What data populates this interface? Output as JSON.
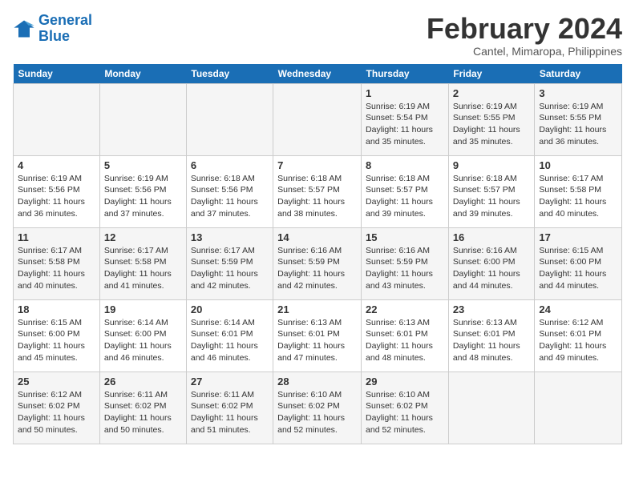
{
  "logo": {
    "general": "General",
    "blue": "Blue"
  },
  "title": "February 2024",
  "location": "Cantel, Mimaropa, Philippines",
  "days_of_week": [
    "Sunday",
    "Monday",
    "Tuesday",
    "Wednesday",
    "Thursday",
    "Friday",
    "Saturday"
  ],
  "weeks": [
    [
      {
        "day": "",
        "info": ""
      },
      {
        "day": "",
        "info": ""
      },
      {
        "day": "",
        "info": ""
      },
      {
        "day": "",
        "info": ""
      },
      {
        "day": "1",
        "info": "Sunrise: 6:19 AM\nSunset: 5:54 PM\nDaylight: 11 hours\nand 35 minutes."
      },
      {
        "day": "2",
        "info": "Sunrise: 6:19 AM\nSunset: 5:55 PM\nDaylight: 11 hours\nand 35 minutes."
      },
      {
        "day": "3",
        "info": "Sunrise: 6:19 AM\nSunset: 5:55 PM\nDaylight: 11 hours\nand 36 minutes."
      }
    ],
    [
      {
        "day": "4",
        "info": "Sunrise: 6:19 AM\nSunset: 5:56 PM\nDaylight: 11 hours\nand 36 minutes."
      },
      {
        "day": "5",
        "info": "Sunrise: 6:19 AM\nSunset: 5:56 PM\nDaylight: 11 hours\nand 37 minutes."
      },
      {
        "day": "6",
        "info": "Sunrise: 6:18 AM\nSunset: 5:56 PM\nDaylight: 11 hours\nand 37 minutes."
      },
      {
        "day": "7",
        "info": "Sunrise: 6:18 AM\nSunset: 5:57 PM\nDaylight: 11 hours\nand 38 minutes."
      },
      {
        "day": "8",
        "info": "Sunrise: 6:18 AM\nSunset: 5:57 PM\nDaylight: 11 hours\nand 39 minutes."
      },
      {
        "day": "9",
        "info": "Sunrise: 6:18 AM\nSunset: 5:57 PM\nDaylight: 11 hours\nand 39 minutes."
      },
      {
        "day": "10",
        "info": "Sunrise: 6:17 AM\nSunset: 5:58 PM\nDaylight: 11 hours\nand 40 minutes."
      }
    ],
    [
      {
        "day": "11",
        "info": "Sunrise: 6:17 AM\nSunset: 5:58 PM\nDaylight: 11 hours\nand 40 minutes."
      },
      {
        "day": "12",
        "info": "Sunrise: 6:17 AM\nSunset: 5:58 PM\nDaylight: 11 hours\nand 41 minutes."
      },
      {
        "day": "13",
        "info": "Sunrise: 6:17 AM\nSunset: 5:59 PM\nDaylight: 11 hours\nand 42 minutes."
      },
      {
        "day": "14",
        "info": "Sunrise: 6:16 AM\nSunset: 5:59 PM\nDaylight: 11 hours\nand 42 minutes."
      },
      {
        "day": "15",
        "info": "Sunrise: 6:16 AM\nSunset: 5:59 PM\nDaylight: 11 hours\nand 43 minutes."
      },
      {
        "day": "16",
        "info": "Sunrise: 6:16 AM\nSunset: 6:00 PM\nDaylight: 11 hours\nand 44 minutes."
      },
      {
        "day": "17",
        "info": "Sunrise: 6:15 AM\nSunset: 6:00 PM\nDaylight: 11 hours\nand 44 minutes."
      }
    ],
    [
      {
        "day": "18",
        "info": "Sunrise: 6:15 AM\nSunset: 6:00 PM\nDaylight: 11 hours\nand 45 minutes."
      },
      {
        "day": "19",
        "info": "Sunrise: 6:14 AM\nSunset: 6:00 PM\nDaylight: 11 hours\nand 46 minutes."
      },
      {
        "day": "20",
        "info": "Sunrise: 6:14 AM\nSunset: 6:01 PM\nDaylight: 11 hours\nand 46 minutes."
      },
      {
        "day": "21",
        "info": "Sunrise: 6:13 AM\nSunset: 6:01 PM\nDaylight: 11 hours\nand 47 minutes."
      },
      {
        "day": "22",
        "info": "Sunrise: 6:13 AM\nSunset: 6:01 PM\nDaylight: 11 hours\nand 48 minutes."
      },
      {
        "day": "23",
        "info": "Sunrise: 6:13 AM\nSunset: 6:01 PM\nDaylight: 11 hours\nand 48 minutes."
      },
      {
        "day": "24",
        "info": "Sunrise: 6:12 AM\nSunset: 6:01 PM\nDaylight: 11 hours\nand 49 minutes."
      }
    ],
    [
      {
        "day": "25",
        "info": "Sunrise: 6:12 AM\nSunset: 6:02 PM\nDaylight: 11 hours\nand 50 minutes."
      },
      {
        "day": "26",
        "info": "Sunrise: 6:11 AM\nSunset: 6:02 PM\nDaylight: 11 hours\nand 50 minutes."
      },
      {
        "day": "27",
        "info": "Sunrise: 6:11 AM\nSunset: 6:02 PM\nDaylight: 11 hours\nand 51 minutes."
      },
      {
        "day": "28",
        "info": "Sunrise: 6:10 AM\nSunset: 6:02 PM\nDaylight: 11 hours\nand 52 minutes."
      },
      {
        "day": "29",
        "info": "Sunrise: 6:10 AM\nSunset: 6:02 PM\nDaylight: 11 hours\nand 52 minutes."
      },
      {
        "day": "",
        "info": ""
      },
      {
        "day": "",
        "info": ""
      }
    ]
  ]
}
